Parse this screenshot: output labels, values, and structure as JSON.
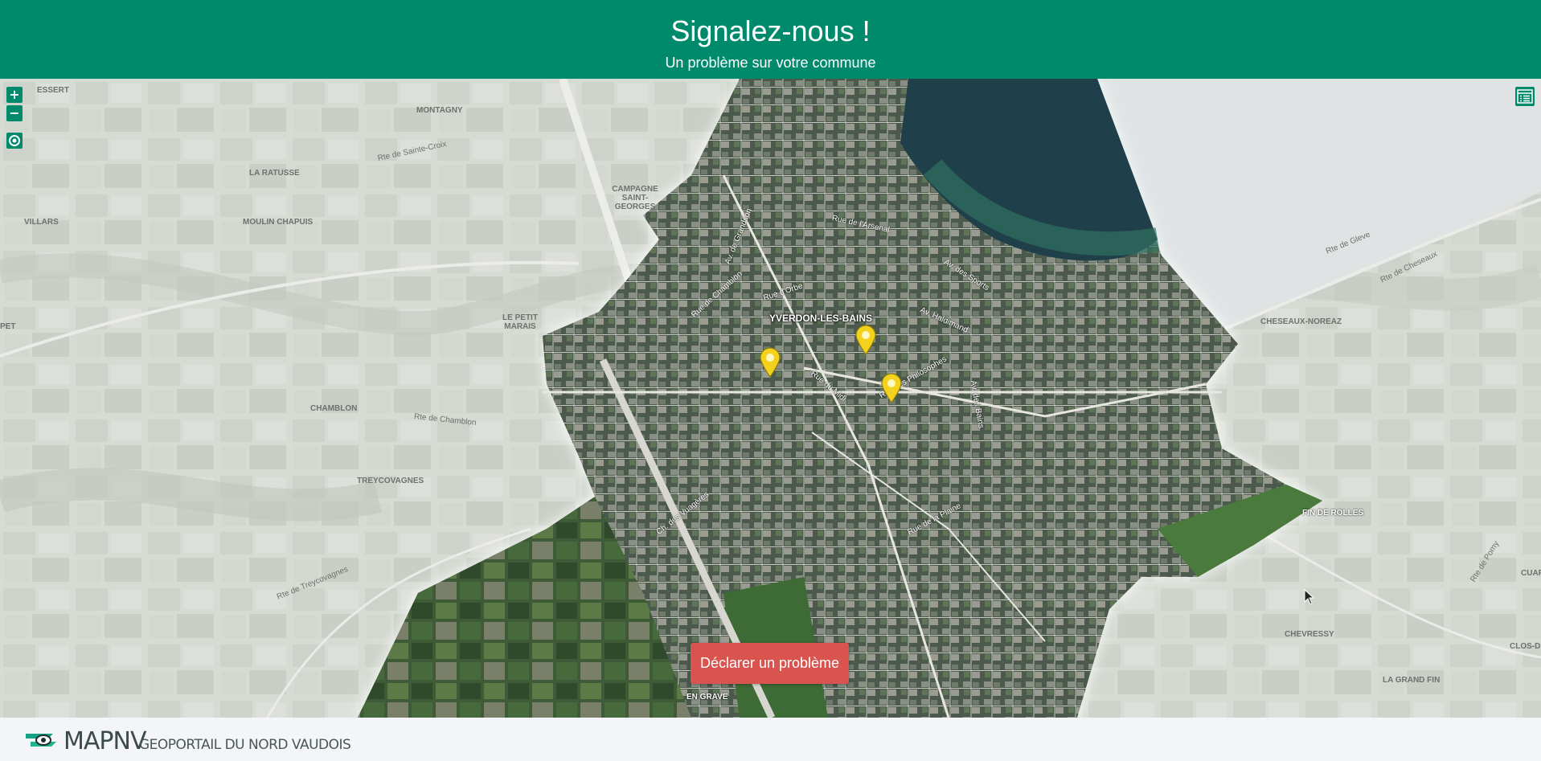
{
  "header": {
    "title": "Signalez-nous !",
    "subtitle": "Un problème sur votre commune"
  },
  "map_controls": {
    "zoom_in": "+",
    "zoom_out": "−",
    "locate_icon": "locate-icon",
    "layers_icon": "layer-list-icon"
  },
  "action": {
    "declare_label": "Déclarer un problème"
  },
  "footer": {
    "brand": "MAPNV",
    "tagline": "GEOPORTAIL DU NORD VAUDOIS"
  },
  "map_labels": {
    "places": [
      "ESSERT",
      "MONTAGNY",
      "LA RATUSSE",
      "MOULIN CHAPUIS",
      "VILLARS",
      "CAMPAGNE SAINT-GEORGES",
      "LE PETIT MARAIS",
      "CHAMBLON",
      "TREYCOVAGNES",
      "CHESEAUX-NOREAZ",
      "FIN DE ROLLES",
      "CHEVRESSY",
      "LA GRAND FIN",
      "CLOS-D",
      "CUAR",
      "EN GRAVE",
      "PET"
    ],
    "city": "YVERDON-LES-BAINS",
    "streets": [
      "Rue de Chamblon",
      "Rue d'Orbe",
      "Av. de Grandson",
      "Rue de l'Arsenal",
      "Av. des Sports",
      "Av. Haldimand",
      "Rue des Philosophes",
      "Rue du Midi",
      "Av. des Bains",
      "Rue de la Plaine",
      "Rte de Sainte-Croix",
      "Rte de Chamblon",
      "Rte de Treycovagnes",
      "Ch. des Vuagères",
      "Rte de Gleve",
      "Rte de Cheseaux",
      "Rte de Pomy"
    ]
  },
  "colors": {
    "header_green": "#008a6c",
    "declare_red": "#d9534f",
    "marker_yellow": "#f2d21c"
  }
}
